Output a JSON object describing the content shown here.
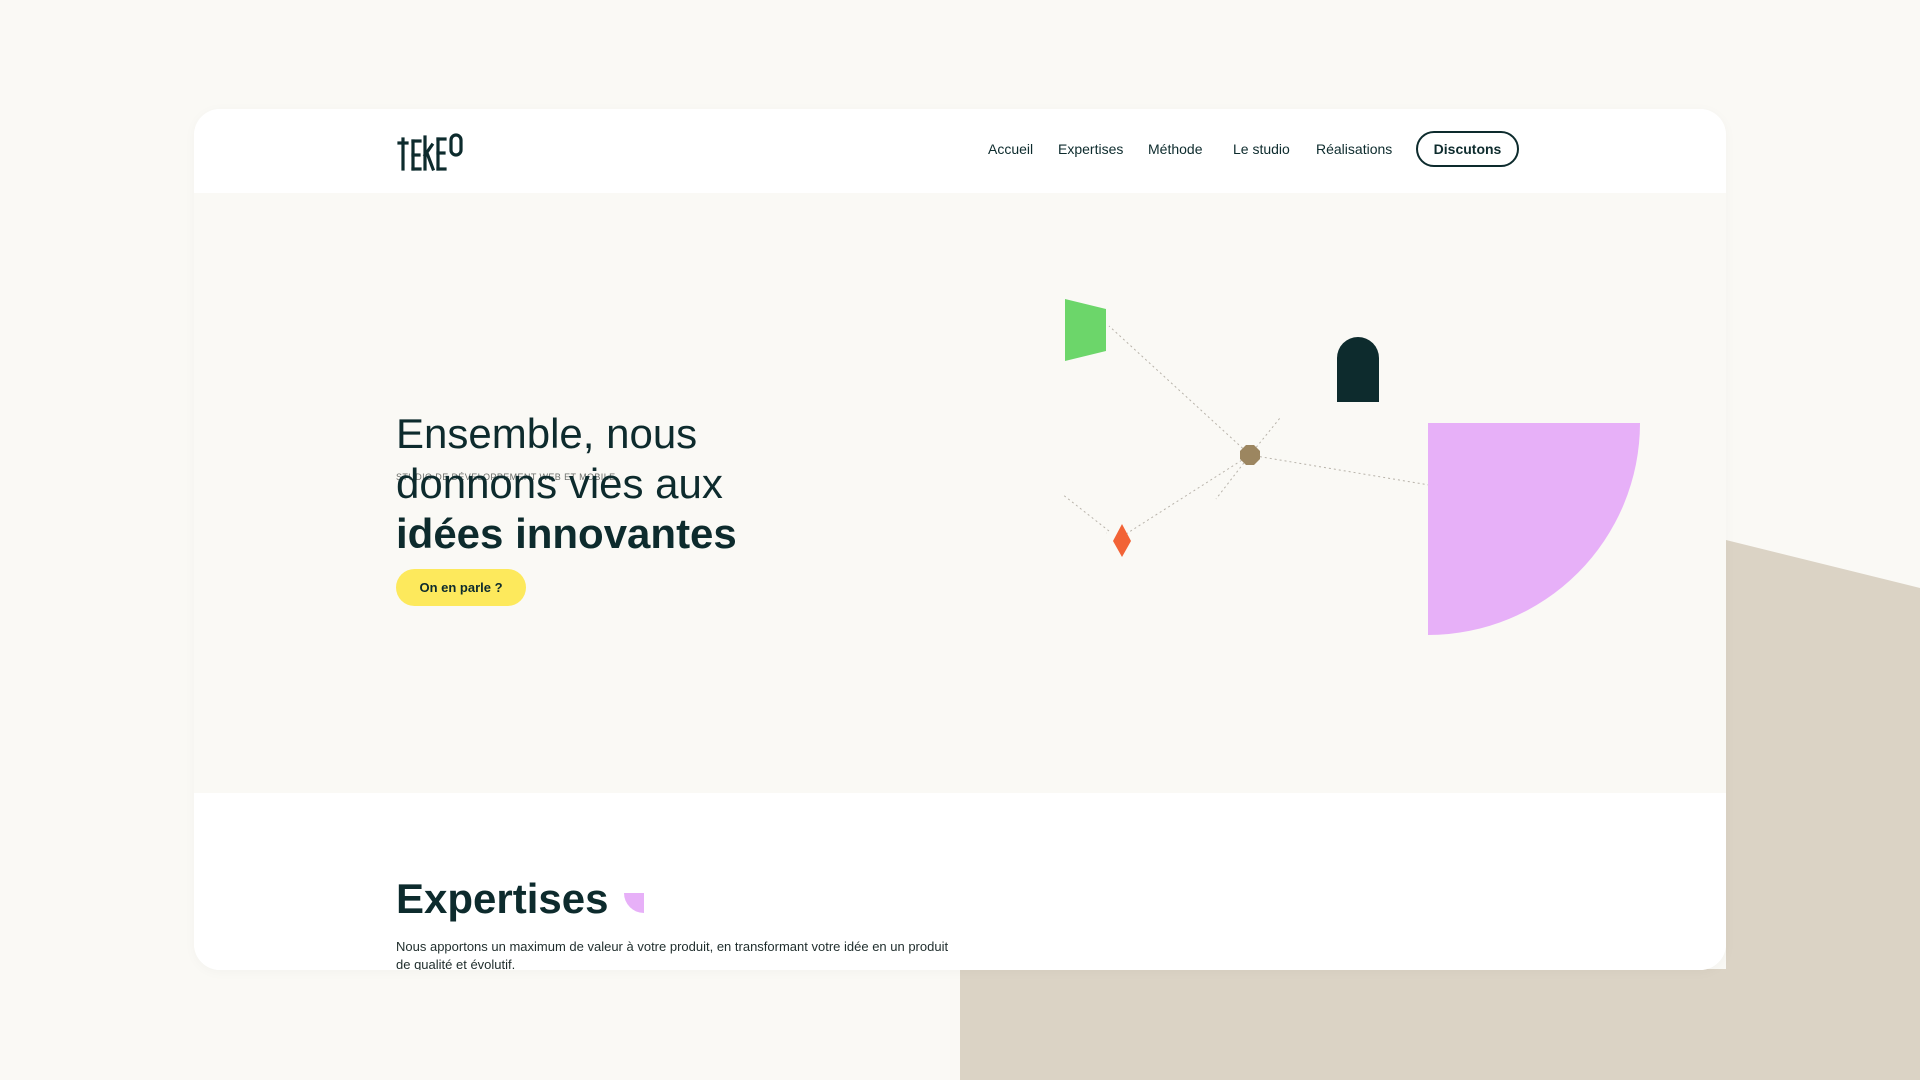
{
  "brand": {
    "logo_text": "tEkEO"
  },
  "nav": {
    "items": [
      {
        "label": "Accueil"
      },
      {
        "label": "Expertises"
      },
      {
        "label": "Méthode"
      },
      {
        "label": "Le studio"
      },
      {
        "label": "Réalisations"
      }
    ],
    "cta_label": "Discutons"
  },
  "hero": {
    "eyebrow": "STUDIO DE DÉVELOPPEMENT WEB ET MOBILE",
    "title_line1": "Ensemble, nous",
    "title_line2": "donnons vies aux",
    "title_bold": "idées innovantes",
    "cta_label": "On en parle ?"
  },
  "expertises": {
    "title": "Expertises",
    "text": "Nous apportons un maximum de valeur à votre produit, en transformant votre idée en un produit de qualité et évolutif."
  },
  "colors": {
    "ink": "#0d2b2d",
    "page_bg": "#faf9f5",
    "beige": "#dbd3c5",
    "yellow": "#fde95c",
    "pink": "#e7b0f8",
    "green": "#6cd66a",
    "orange": "#f26336",
    "khaki": "#9c8660"
  },
  "icons": {
    "hero_shapes": [
      "green-flag-shape",
      "dark-arch-shape",
      "khaki-octagon-node",
      "orange-diamond-shape",
      "pink-quarter-circle-shape"
    ],
    "section_deco": "pink-quarter-circle-icon"
  }
}
